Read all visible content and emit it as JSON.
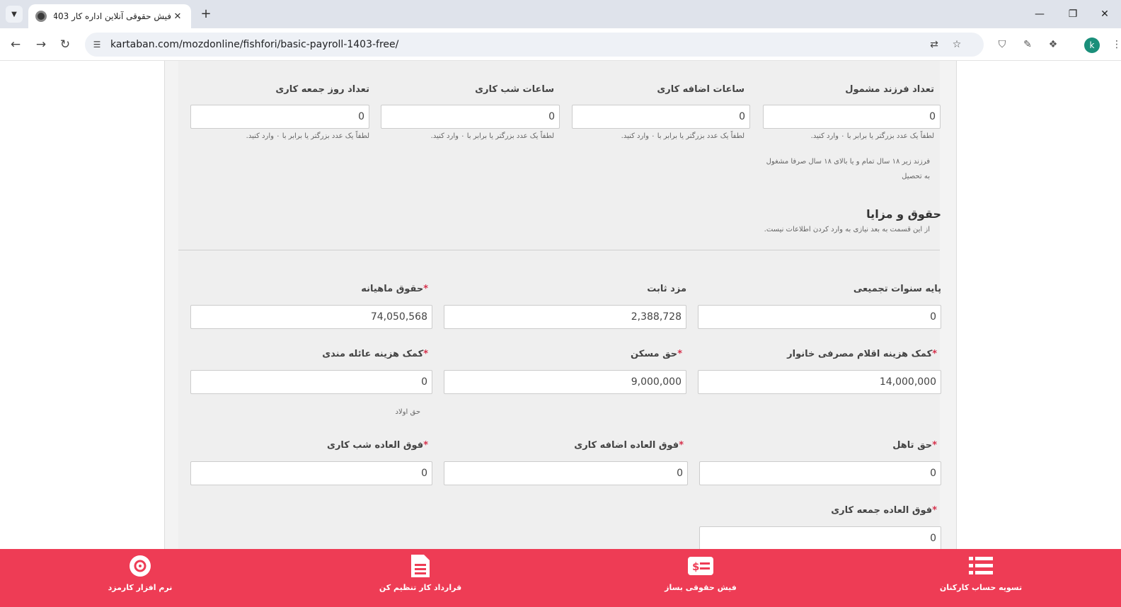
{
  "browser": {
    "tab_title": "فیش حقوقی آنلاین اداره کار 1403",
    "url": "kartaban.com/mozdonline/fishfori/basic-payroll-1403-free/",
    "profile_initial": "k",
    "icons": {
      "tab_search": "chevron-down-icon",
      "tab_close": "close-icon",
      "new_tab": "plus-icon",
      "back": "back-arrow-icon",
      "forward": "forward-arrow-icon",
      "reload": "reload-icon",
      "translate": "translate-icon",
      "bookmark": "star-icon"
    }
  },
  "form": {
    "row1": [
      {
        "label": "تعداد فرزند مشمول",
        "value": "0",
        "help": "لطفاً یک عدد بزرگتر یا برابر با ۰ وارد کنید."
      },
      {
        "label": "ساعات اضافه کاری",
        "value": "0",
        "help": "لطفاً یک عدد بزرگتر یا برابر با ۰ وارد کنید."
      },
      {
        "label": "ساعات شب کاری",
        "value": "0",
        "help": "لطفاً یک عدد بزرگتر یا برابر با ۰ وارد کنید."
      },
      {
        "label": "تعداد روز جمعه کاری",
        "value": "0",
        "help": "لطفاً یک عدد بزرگتر یا برابر با ۰ وارد کنید."
      }
    ],
    "child_note_line1": "فرزند زیر ۱۸ سال تمام و یا بالای ۱۸ سال صرفا مشغول",
    "child_note_line2": "به تحصیل",
    "section_title": "حقوق و مزایا",
    "section_subtitle": "از این قسمت به بعد نیازی به وارد کردن اطلاعات نیست.",
    "required_mark": "*",
    "row2": [
      {
        "label": "پایه سنوات تجمیعی",
        "value": "0"
      },
      {
        "label": "مزد ثابت",
        "value": "2,388,728"
      },
      {
        "label": "حقوق ماهیانه",
        "value": "74,050,568"
      }
    ],
    "row3": [
      {
        "label": "کمک هزینه اقلام مصرفی خانوار",
        "value": "14,000,000"
      },
      {
        "label": "حق مسکن",
        "value": "9,000,000"
      },
      {
        "label": "کمک هزینه عائله مندی",
        "value": "0",
        "help": "حق اولاد"
      }
    ],
    "row4": [
      {
        "label": "حق تاهل",
        "value": "0"
      },
      {
        "label": "فوق العاده اضافه کاری",
        "value": "0"
      },
      {
        "label": "فوق العاده شب کاری",
        "value": "0"
      }
    ],
    "row5": [
      {
        "label": "فوق العاده جمعه کاری",
        "value": "0"
      }
    ]
  },
  "bottom_bar": {
    "items": [
      {
        "label": "تسویه حساب کارکنان",
        "icon": "list-icon"
      },
      {
        "label": "فیش حقوقی بساز",
        "icon": "money-slip-icon"
      },
      {
        "label": "قرارداد کار تنظیم کن",
        "icon": "document-icon"
      },
      {
        "label": "نرم افزار کارمزد",
        "icon": "disc-icon"
      }
    ]
  },
  "colors": {
    "accent": "#ee3c55",
    "required": "#d6314c"
  }
}
